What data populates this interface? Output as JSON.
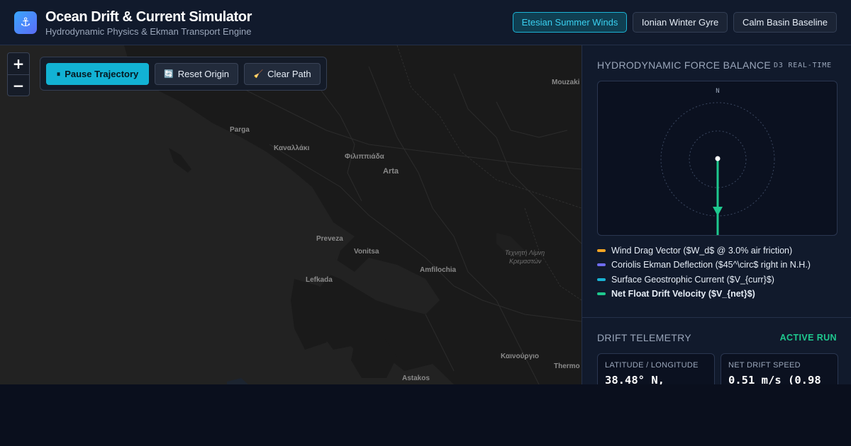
{
  "header": {
    "logo_glyph": "⚓",
    "logo_icon": "anchor-icon",
    "title": "Ocean Drift & Current Simulator",
    "subtitle": "Hydrodynamic Physics & Ekman Transport Engine",
    "presets": [
      {
        "label": "Etesian Summer Winds",
        "active": true
      },
      {
        "label": "Ionian Winter Gyre",
        "active": false
      },
      {
        "label": "Calm Basin Baseline",
        "active": false
      }
    ]
  },
  "map": {
    "zoom_in": "+",
    "zoom_out": "−",
    "controls": {
      "pause_icon": "⏸",
      "pause_label": "Pause Trajectory",
      "reset_icon": "🔄",
      "reset_label": "Reset Origin",
      "clear_icon": "🧹",
      "clear_label": "Clear Path"
    },
    "labels": {
      "mouzaki": "Mouzaki",
      "parga": "Parga",
      "kanallaki": "Καναλλάκι",
      "filippiada": "Φιλιππιάδα",
      "arta": "Arta",
      "preveza": "Preveza",
      "vonitsa": "Vonitsa",
      "lake1": "Τεχνητή Λίμνη",
      "lake2": "Κρεμαστών",
      "amfilochia": "Amfilochia",
      "lefkada": "Lefkada",
      "kainourgio": "Καινούργιο",
      "thermo": "Thermo",
      "astakos": "Astakos"
    }
  },
  "sidebar": {
    "force": {
      "title": "HYDRODYNAMIC FORCE BALANCE",
      "badge": "D3 REAL-TIME",
      "compass_north": "N",
      "legend": [
        {
          "label": "Wind Drag Vector ($W_d$ @ 3.0% air friction)",
          "color": "#f5a524"
        },
        {
          "label": "Coriolis Ekman Deflection ($45^\\circ$ right in N.H.)",
          "color": "#6f6cf0"
        },
        {
          "label": "Surface Geostrophic Current ($V_{curr}$)",
          "color": "#19b3d4"
        },
        {
          "label": "Net Float Drift Velocity ($V_{net}$)",
          "color": "#1ec88e"
        }
      ]
    },
    "telemetry": {
      "title": "DRIFT TELEMETRY",
      "status": "ACTIVE RUN",
      "cards": [
        {
          "label": "LATITUDE / LONGITUDE",
          "value": "38.48° N,"
        },
        {
          "label": "NET DRIFT SPEED",
          "value": "0.51 m/s (0.98"
        }
      ]
    }
  }
}
